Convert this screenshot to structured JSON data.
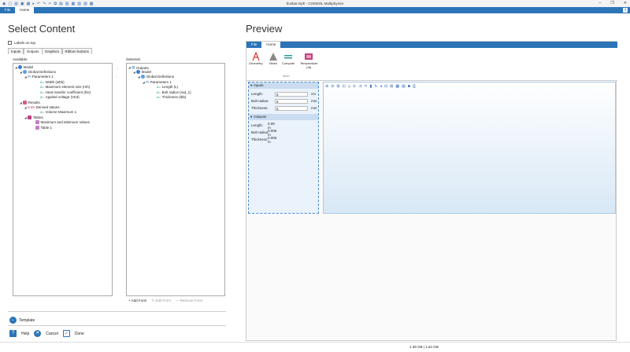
{
  "window": {
    "title": "busbar.mph - COMSOL Multiphysics",
    "minimize": "–",
    "restore": "❐",
    "close": "✕"
  },
  "menubar": {
    "file": "File",
    "home": "Home"
  },
  "left": {
    "title": "Select Content",
    "labels_on_top": "Labels on top",
    "tabs": [
      "Inputs",
      "Outputs",
      "Graphics",
      "Ribbon buttons"
    ],
    "available_label": "Available:",
    "selected_label": "Selected:",
    "available": {
      "model": "Model",
      "global_defs": "Global Definitions",
      "params": "Parameters 1",
      "p1": "Width (wbb)",
      "p2": "Maximum element size (mh)",
      "p3": "Heat transfer coefficient (htc)",
      "p4": "Applied voltage (Vtot)",
      "results": "Results",
      "derived": "Derived Values",
      "volmax": "Volume Maximum 1",
      "tables": "Tables",
      "maxmin": "Maximum and Minimum Values",
      "table1": "Table 1"
    },
    "selected": {
      "outputs": "Outputs",
      "model": "Model",
      "global_defs": "Global Definitions",
      "params": "Parameters 1",
      "s1": "Length (L)",
      "s2": "Bolt radius (rad_1)",
      "s3": "Thickness (tbb)"
    },
    "form_buttons": {
      "add": "+ Add Form",
      "edit": "Edit Form",
      "remove": "— Remove Form"
    },
    "template": "Template",
    "help": "Help",
    "cancel": "Cancel",
    "done": "Done"
  },
  "preview": {
    "title": "Preview",
    "menu": {
      "file": "File",
      "home": "Home"
    },
    "ribbon": {
      "geometry": "Geometry",
      "mesh": "Mesh",
      "compute": "Compute",
      "temperature": "Temperature",
      "temperature_unit": "(ht)",
      "group": "Main"
    },
    "inputs_header": "Inputs",
    "inputs": [
      {
        "label": "Length:",
        "value": "9",
        "unit": "cm"
      },
      {
        "label": "Bolt radius:",
        "value": "6",
        "unit": "mm"
      },
      {
        "label": "Thickness:",
        "value": "5",
        "unit": "mm"
      }
    ],
    "outputs_header": "Outputs",
    "outputs": [
      {
        "label": "Length:",
        "value": "0.09 m"
      },
      {
        "label": "Bolt radius:",
        "value": "0.006 m"
      },
      {
        "label": "Thickness:",
        "value": "0.005 m"
      }
    ]
  },
  "status": "1.38 GB | 1.64 GB",
  "colors": {
    "accent": "#2b74b8",
    "cancel": "#2b74b8",
    "done": "#2b74b8"
  }
}
